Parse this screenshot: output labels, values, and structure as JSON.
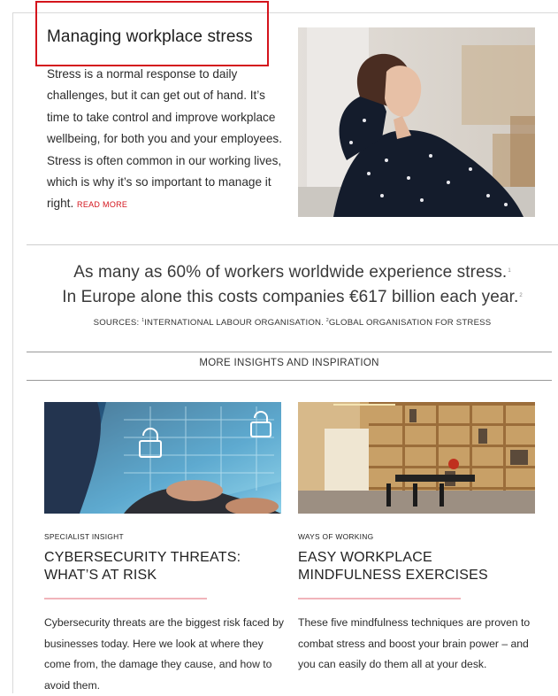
{
  "hero": {
    "title": "Managing workplace stress",
    "body": "Stress is a normal response to daily challenges, but it can get out of hand. It’s time to take control and improve workplace wellbeing, for both you and your employees. Stress is often common in our working lives, which is why it’s so important to manage it right.",
    "read_more": "READ MORE"
  },
  "stats": {
    "line1": "As many as 60% of workers worldwide experience stress.",
    "line1_ref": "1",
    "line2": "In Europe alone this costs companies €617 billion each year.",
    "line2_ref": "2",
    "sources_label": "SOURCES:",
    "source1_ref": "1",
    "source1": "INTERNATIONAL LABOUR ORGANISATION.",
    "source2_ref": "2",
    "source2": "GLOBAL ORGANISATION FOR STRESS"
  },
  "section": {
    "heading": "MORE INSIGHTS AND INSPIRATION"
  },
  "cards": [
    {
      "category": "SPECIALIST INSIGHT",
      "title": "CYBERSECURITY THREATS: WHAT’S AT RISK",
      "text": "Cybersecurity threats are the biggest risk faced by businesses today. Here we look at where they come from, the damage they cause, and how to avoid them."
    },
    {
      "category": "WAYS OF WORKING",
      "title": "EASY WORKPLACE MINDFULNESS EXERCISES",
      "text": "These five mindfulness techniques are proven to combat stress and boost your brain power – and you can easily do them all at your desk."
    }
  ],
  "colors": {
    "accent": "#d4141c",
    "divider": "#f1b4ba"
  }
}
